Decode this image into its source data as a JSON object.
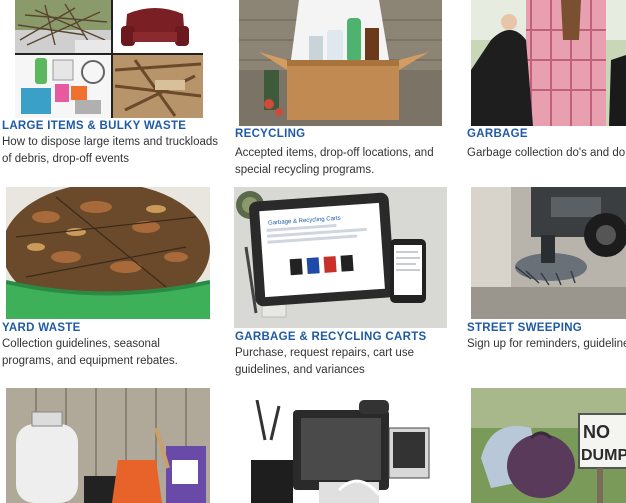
{
  "cards": [
    {
      "title": "LARGE ITEMS & BULKY WASTE",
      "desc": "How to dispose large items and truckloads of debris, drop-off events"
    },
    {
      "title": "RECYCLING",
      "desc": "Accepted items, drop-off locations, and special recycling programs."
    },
    {
      "title": "GARBAGE",
      "desc": "Garbage collection do's and don'ts"
    },
    {
      "title": "YARD WASTE",
      "desc": "Collection guidelines, seasonal programs, and equipment rebates."
    },
    {
      "title": "GARBAGE & RECYCLING CARTS",
      "desc": "Purchase, request repairs, cart use guidelines, and variances"
    },
    {
      "title": "STREET SWEEPING",
      "desc": "Sign up for reminders, guidelines"
    }
  ],
  "images": {
    "tablet_title": "Garbage & Recycling Carts",
    "sign_text_1": "NO",
    "sign_text_2": "DUMP"
  },
  "colors": {
    "link": "#1f5aa6",
    "text": "#333333"
  }
}
